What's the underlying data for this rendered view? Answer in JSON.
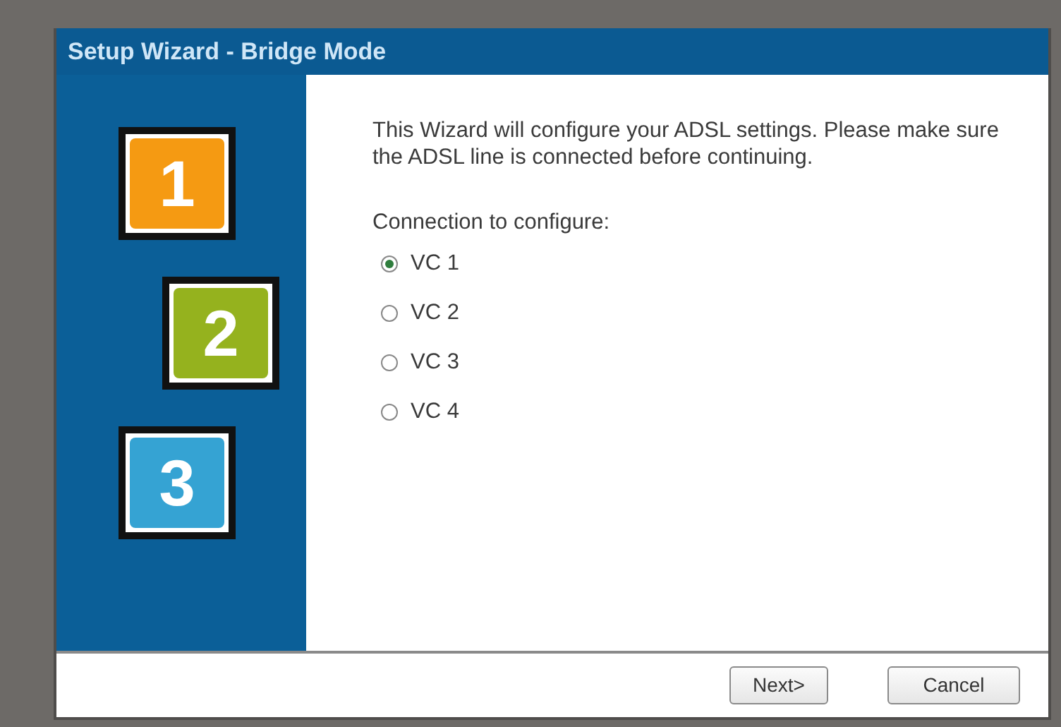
{
  "window": {
    "title": "Setup Wizard - Bridge Mode"
  },
  "steps": [
    {
      "label": "1",
      "color": "#f59a12"
    },
    {
      "label": "2",
      "color": "#95b21e"
    },
    {
      "label": "3",
      "color": "#35a3d3"
    }
  ],
  "intro": "This Wizard will configure your ADSL settings. Please make sure the ADSL line is connected before continuing.",
  "connection": {
    "label": "Connection to configure:",
    "options": [
      {
        "label": "VC 1",
        "selected": true
      },
      {
        "label": "VC 2",
        "selected": false
      },
      {
        "label": "VC 3",
        "selected": false
      },
      {
        "label": "VC 4",
        "selected": false
      }
    ]
  },
  "buttons": [
    "Next>",
    "Cancel"
  ]
}
